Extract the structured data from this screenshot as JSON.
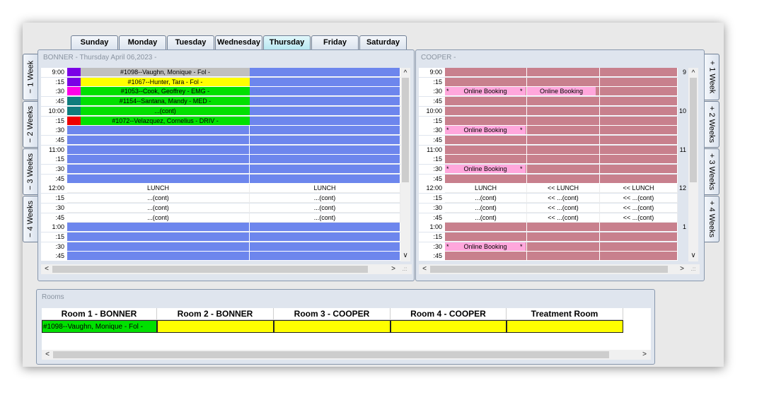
{
  "day_tabs": [
    {
      "label": "Sunday",
      "active": false
    },
    {
      "label": "Monday",
      "active": false
    },
    {
      "label": "Tuesday",
      "active": false
    },
    {
      "label": "Wednesday",
      "active": false
    },
    {
      "label": "Thursday",
      "active": true
    },
    {
      "label": "Friday",
      "active": false
    },
    {
      "label": "Saturday",
      "active": false
    }
  ],
  "left_week_tabs": [
    "− 1 Week",
    "− 2 Weeks",
    "− 3 Weeks",
    "− 4 Weeks"
  ],
  "right_week_tabs": [
    "+ 1 Week",
    "+ 2 Weeks",
    "+ 3 Weeks",
    "+ 4 Weeks"
  ],
  "times": [
    "9:00",
    ":15",
    ":30",
    ":45",
    "10:00",
    ":15",
    ":30",
    ":45",
    "11:00",
    ":15",
    ":30",
    ":45",
    "12:00",
    ":15",
    ":30",
    ":45",
    "1:00",
    ":15",
    ":30",
    ":45"
  ],
  "colors": {
    "slot_blue": "#6d86ed",
    "slot_rose": "#c8808d",
    "online_booking_pink": "#ffa7dc",
    "appt_yellow": "#ffff00",
    "appt_green": "#00e000",
    "appt_gray": "#c0c0c0"
  },
  "bonner": {
    "title": "BONNER - Thursday April 06,2023 -",
    "appointments": [
      {
        "text": "#1098--Vaughn, Monique - Fol -",
        "bg": "#c0c0c0",
        "status": "#7a00e6"
      },
      {
        "text": "#1067--Hunter, Tara - Fol -",
        "bg": "#ffff00",
        "status": "#7a00e6"
      },
      {
        "text": "#1053--Cook, Geoffrey - EMG -",
        "bg": "#00e000",
        "status": "#ff00e6"
      },
      {
        "text": "#1154--Santana, Mandy - MED -",
        "bg": "#00e000",
        "status": "#0e7d7d"
      },
      {
        "text": "...(cont)",
        "bg": "#00e000",
        "status": "#0e7d7d"
      },
      {
        "text": "#1072--Velazquez, Cornelius - DRIV -",
        "bg": "#00e000",
        "status": "#ee0000"
      }
    ],
    "lunch_rows": [
      [
        "LUNCH",
        "LUNCH"
      ],
      [
        "...(cont)",
        "...(cont)"
      ],
      [
        "...(cont)",
        "...(cont)"
      ],
      [
        "...(cont)",
        "...(cont)"
      ]
    ]
  },
  "cooper": {
    "title": "COOPER -",
    "online_booking_label": "Online Booking",
    "star": "*",
    "hour_marks": [
      "9",
      "10",
      "11",
      "12",
      "1"
    ],
    "lunch_rows": [
      [
        "LUNCH",
        "<<  LUNCH",
        "<<  LUNCH"
      ],
      [
        "...(cont)",
        "<<  ...(cont)",
        "<<  ...(cont)"
      ],
      [
        "...(cont)",
        "<<  ...(cont)",
        "<<  ...(cont)"
      ],
      [
        "...(cont)",
        "<<  ...(cont)",
        "<<  ...(cont)"
      ]
    ]
  },
  "rooms": {
    "title": "Rooms",
    "columns": [
      "Room 1 - BONNER",
      "Room 2 - BONNER",
      "Room 3 - COOPER",
      "Room 4 - COOPER",
      "Treatment Room"
    ],
    "occupants": [
      "#1098--Vaughn, Monique - Fol -",
      "",
      "",
      "",
      ""
    ]
  },
  "arrows": {
    "up": "^",
    "down": "∨",
    "left": "<",
    "right": ">",
    "grip": ".::"
  }
}
